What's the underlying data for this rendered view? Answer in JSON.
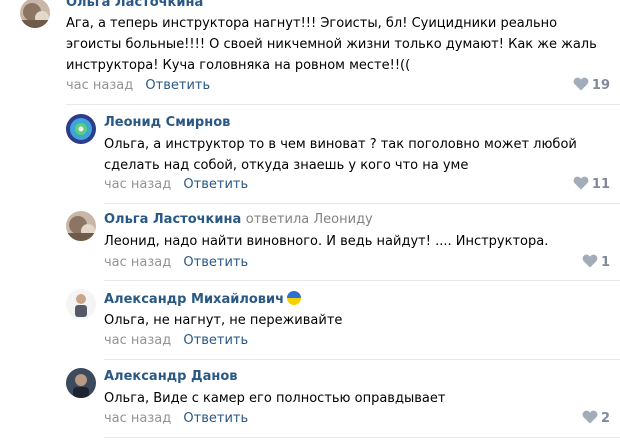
{
  "comments": [
    {
      "author": "Ольга Ласточкина",
      "lines": [
        "Ага, а теперь инструктора нагнут!!! Эгоисты, бл! Суицидники реально",
        "эгоисты больные!!!! О своей никчемной жизни только думают! Как же жаль",
        "инструктора! Куча головняка на ровном месте!!(("
      ],
      "time": "час назад",
      "reply": "Ответить",
      "likes": "19"
    },
    {
      "author": "Леонид Смирнов",
      "lines": [
        "Ольга, а инструктор то в чем виноват ? так поголовно может любой",
        "сделать над собой, откуда знаешь у кого что на уме"
      ],
      "time": "час назад",
      "reply": "Ответить",
      "likes": "11"
    },
    {
      "author": "Ольга Ласточкина",
      "replied_to": "ответила Леониду",
      "lines": [
        "Леонид, надо найти виновного. И ведь найдут! .... Инструктора."
      ],
      "time": "час назад",
      "reply": "Ответить",
      "likes": "1"
    },
    {
      "author": "Александр Михайлович",
      "lines": [
        "Ольга, не нагнут, не переживайте"
      ],
      "time": "час назад",
      "reply": "Ответить"
    },
    {
      "author": "Александр Данов",
      "lines": [
        "Ольга, Виде с камер его полностью оправдывает"
      ],
      "time": "час назад",
      "reply": "Ответить",
      "likes": "2"
    }
  ],
  "colors": {
    "author": "#2a5885",
    "meta": "#939393",
    "likes": "#828a99",
    "separator": "#e7e8ec"
  }
}
